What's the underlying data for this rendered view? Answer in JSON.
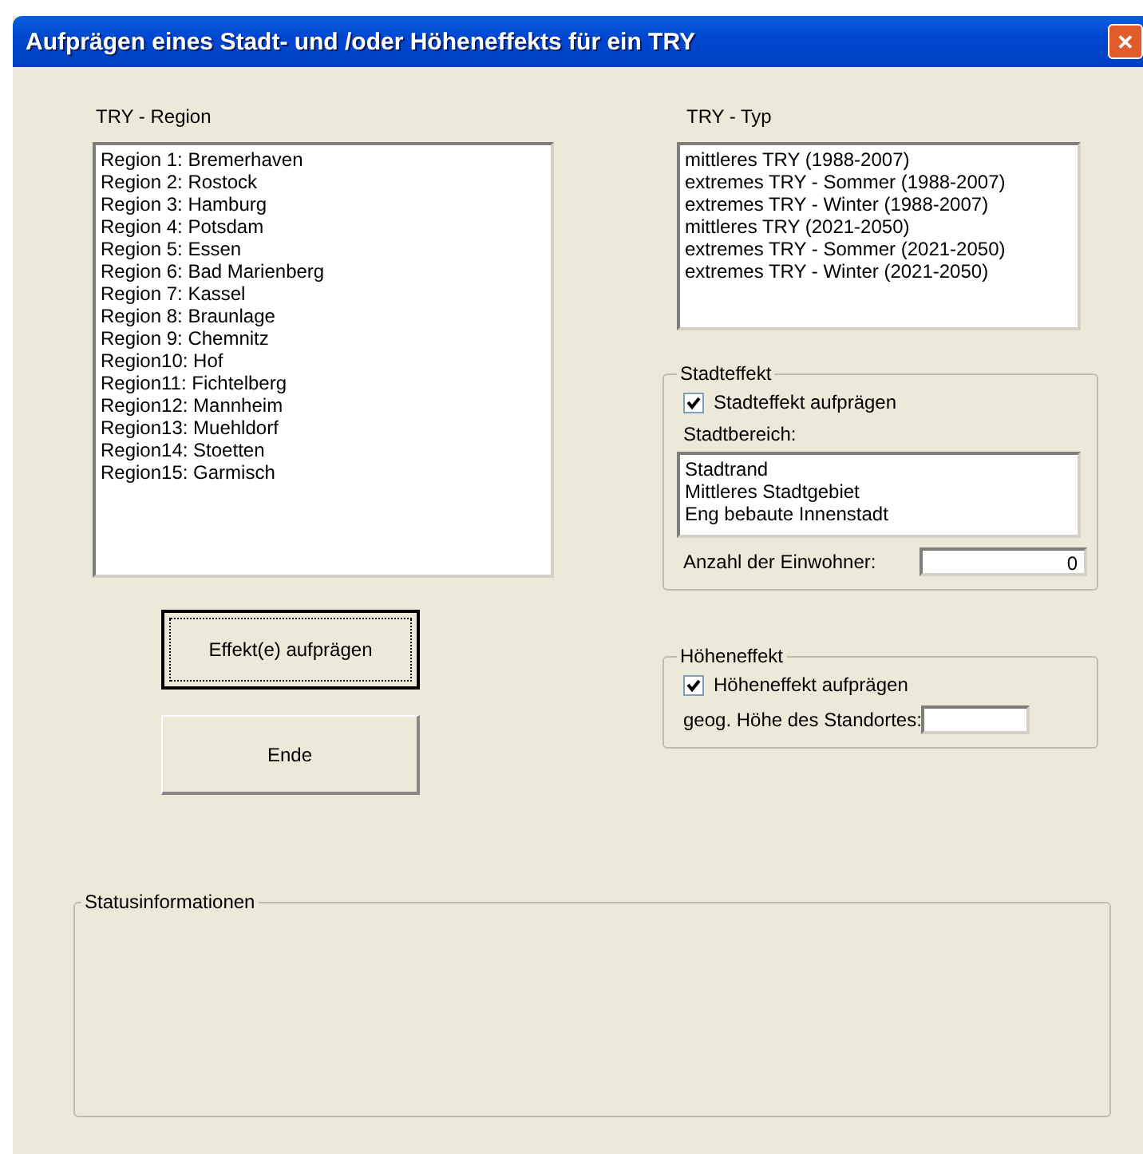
{
  "window": {
    "title": "Aufprägen eines Stadt- und /oder Höheneffekts für ein TRY",
    "close": "✕"
  },
  "region": {
    "label": "TRY - Region",
    "items": [
      "Region 1: Bremerhaven",
      "Region 2: Rostock",
      "Region 3: Hamburg",
      "Region 4: Potsdam",
      "Region 5: Essen",
      "Region 6: Bad Marienberg",
      "Region 7: Kassel",
      "Region 8: Braunlage",
      "Region 9: Chemnitz",
      "Region10: Hof",
      "Region11: Fichtelberg",
      "Region12: Mannheim",
      "Region13: Muehldorf",
      "Region14: Stoetten",
      "Region15: Garmisch"
    ]
  },
  "buttons": [
    {
      "label": "Effekt(e) aufprägen",
      "focused": true
    },
    {
      "label": "Ende",
      "focused": false
    }
  ],
  "typ": {
    "label": "TRY - Typ",
    "items": [
      "mittleres TRY (1988-2007)",
      "extremes TRY - Sommer (1988-2007)",
      "extremes TRY - Winter (1988-2007)",
      "mittleres TRY (2021-2050)",
      "extremes TRY - Sommer (2021-2050)",
      "extremes TRY - Winter (2021-2050)"
    ]
  },
  "stadteffekt": {
    "title": "Stadteffekt",
    "checkbox": {
      "label": "Stadteffekt aufprägen",
      "checked": true
    },
    "bereich_label": "Stadtbereich:",
    "bereich_items": [
      "Stadtrand",
      "Mittleres Stadtgebiet",
      "Eng bebaute Innenstadt"
    ],
    "einwohner_label": "Anzahl der Einwohner:",
    "einwohner_value": "0"
  },
  "hoeheneffekt": {
    "title": "Höheneffekt",
    "checkbox": {
      "label": "Höheneffekt aufprägen",
      "checked": true
    },
    "hoehe_label": "geog. Höhe des Standortes:"
  },
  "status": {
    "title": "Statusinformationen"
  }
}
